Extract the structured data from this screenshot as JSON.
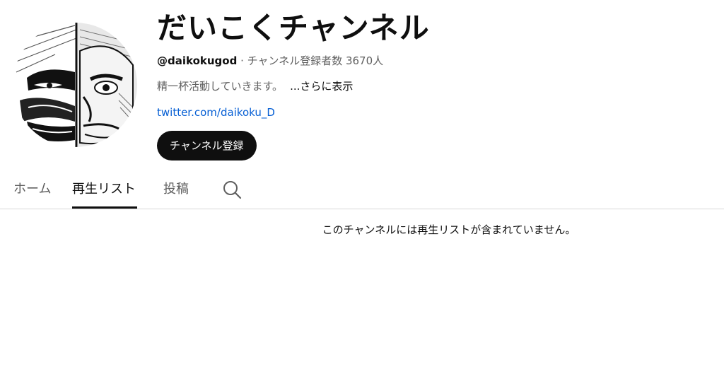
{
  "channel": {
    "name": "だいこくチャンネル",
    "handle": "@daikokugod",
    "separator": " · ",
    "subscribers": "チャンネル登録者数 3670人",
    "description": "精一杯活動していきます。",
    "more_label": "...さらに表示",
    "link": "twitter.com/daikoku_D",
    "subscribe_label": "チャンネル登録"
  },
  "tabs": [
    {
      "label": "ホーム",
      "active": false
    },
    {
      "label": "再生リスト",
      "active": true
    },
    {
      "label": "投稿",
      "active": false
    }
  ],
  "empty_message": "このチャンネルには再生リストが含まれていません。",
  "icons": {
    "search": "search-icon"
  },
  "colors": {
    "link": "#065fd4",
    "subscribe_bg": "#0f0f0f",
    "secondary_text": "#606060"
  }
}
